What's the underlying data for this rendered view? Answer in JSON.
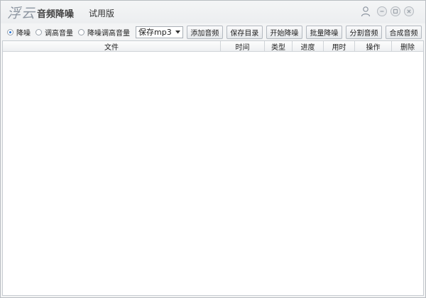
{
  "app": {
    "logo_text": "浮云",
    "name": "音频降噪",
    "edition": "试用版"
  },
  "window_controls": {
    "user_icon": "user-icon",
    "minimize_icon": "minimize-icon",
    "restore_icon": "restore-icon",
    "close_icon": "close-icon"
  },
  "toolbar": {
    "modes": [
      {
        "label": "降噪",
        "checked": true
      },
      {
        "label": "调高音量",
        "checked": false
      },
      {
        "label": "降噪调高音量",
        "checked": false
      }
    ],
    "format_select": "保存mp3",
    "buttons": [
      "添加音频",
      "保存目录",
      "开始降噪",
      "批量降噪",
      "分割音频",
      "合成音频"
    ]
  },
  "table": {
    "columns": [
      "文件",
      "时间",
      "类型",
      "进度",
      "用时",
      "操作",
      "删除"
    ],
    "rows": []
  },
  "colors": {
    "accent": "#2a78d6",
    "border": "#b9bdc2",
    "background": "#f3f4f5"
  }
}
